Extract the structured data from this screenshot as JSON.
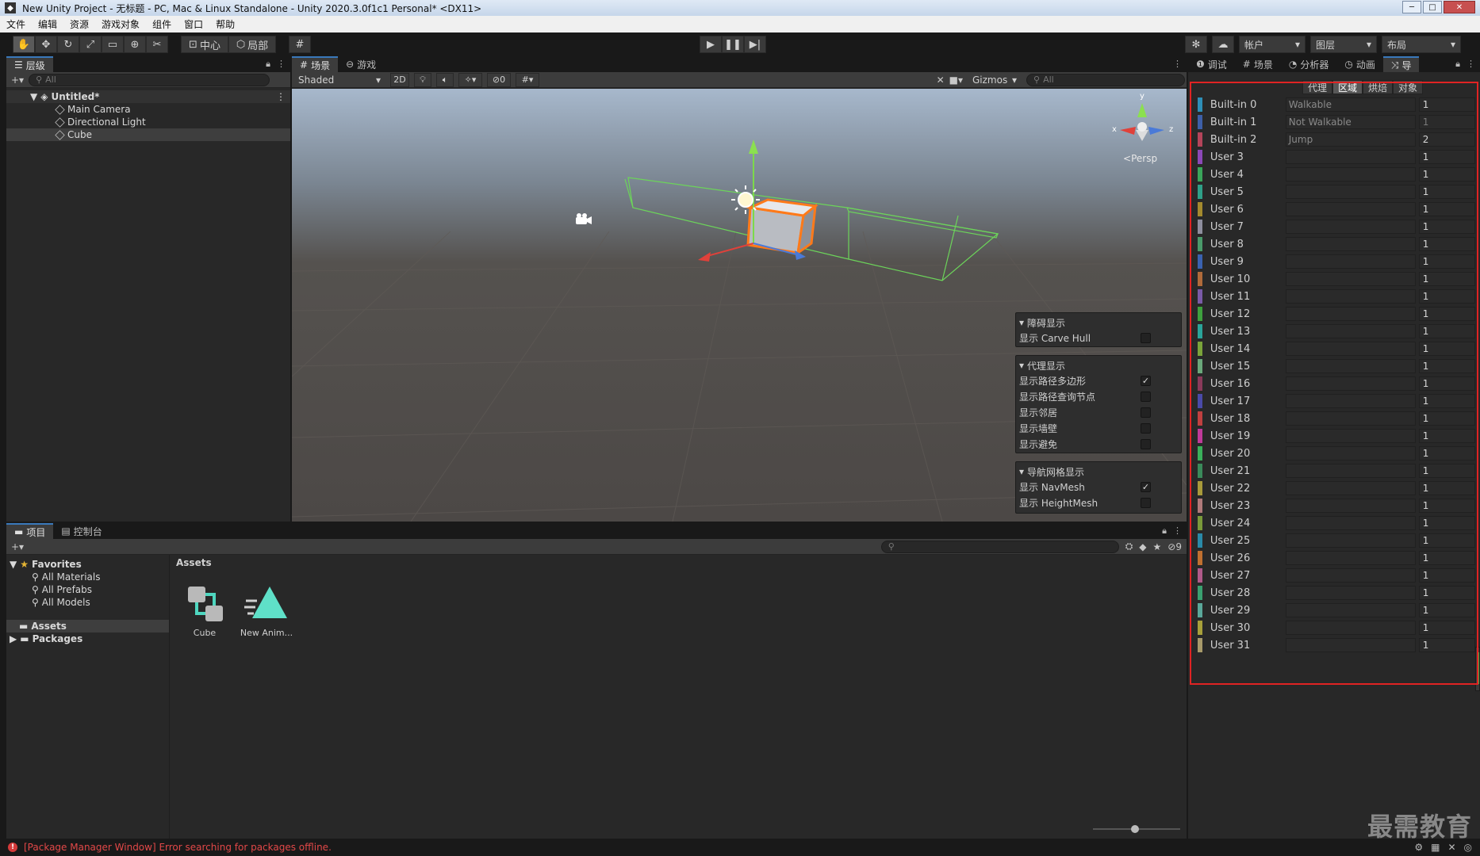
{
  "window": {
    "title": "New Unity Project - 无标题 - PC, Mac & Linux Standalone - Unity 2020.3.0f1c1 Personal* <DX11>",
    "app_icon": "unity-logo-icon"
  },
  "menu": [
    "文件",
    "编辑",
    "资源",
    "游戏对象",
    "组件",
    "窗口",
    "帮助"
  ],
  "toolbar": {
    "pivot_label": "中心",
    "space_label": "局部",
    "account_label": "帐户",
    "layers_label": "图层",
    "layout_label": "布局"
  },
  "hierarchy": {
    "tab_label": "层级",
    "search_placeholder": "All",
    "scene_name": "Untitled*",
    "objects": [
      "Main Camera",
      "Directional Light",
      "Cube"
    ]
  },
  "scene_view": {
    "tabs": [
      "场景",
      "游戏"
    ],
    "shading_mode": "Shaded",
    "mode_2d": "2D",
    "hidden_count": "0",
    "gizmos_label": "Gizmos",
    "search_placeholder": "All",
    "persp_label": "Persp",
    "axis_labels": {
      "y": "y",
      "x": "x",
      "z": "z"
    },
    "overlays": {
      "obstacle": {
        "title": "障碍显示",
        "rows": [
          {
            "label": "显示 Carve Hull",
            "checked": false
          }
        ]
      },
      "agent": {
        "title": "代理显示",
        "rows": [
          {
            "label": "显示路径多边形",
            "checked": true
          },
          {
            "label": "显示路径查询节点",
            "checked": false
          },
          {
            "label": "显示邻居",
            "checked": false
          },
          {
            "label": "显示墙壁",
            "checked": false
          },
          {
            "label": "显示避免",
            "checked": false
          }
        ]
      },
      "navmesh": {
        "title": "导航网格显示",
        "rows": [
          {
            "label": "显示 NavMesh",
            "checked": true
          },
          {
            "label": "显示 HeightMesh",
            "checked": false
          }
        ]
      }
    }
  },
  "inspector": {
    "tabs": [
      "调试",
      "场景",
      "分析器",
      "动画",
      "导"
    ],
    "nav_tabs": [
      "代理",
      "区域",
      "烘焙",
      "对象"
    ],
    "active_nav_tab": "区域",
    "areas": [
      {
        "label": "Built-in 0",
        "name": "Walkable",
        "cost": "1",
        "color": "#2e8fb8"
      },
      {
        "label": "Built-in 1",
        "name": "Not Walkable",
        "cost": "1",
        "color": "#3d5fa8"
      },
      {
        "label": "Built-in 2",
        "name": "Jump",
        "cost": "2",
        "color": "#b4445a"
      },
      {
        "label": "User 3",
        "name": "",
        "cost": "1",
        "color": "#8b48b8"
      },
      {
        "label": "User 4",
        "name": "",
        "cost": "1",
        "color": "#3aa55a"
      },
      {
        "label": "User 5",
        "name": "",
        "cost": "1",
        "color": "#2fa088"
      },
      {
        "label": "User 6",
        "name": "",
        "cost": "1",
        "color": "#a48a2e"
      },
      {
        "label": "User 7",
        "name": "",
        "cost": "1",
        "color": "#8e8e9e"
      },
      {
        "label": "User 8",
        "name": "",
        "cost": "1",
        "color": "#4a9a6a"
      },
      {
        "label": "User 9",
        "name": "",
        "cost": "1",
        "color": "#3a62b0"
      },
      {
        "label": "User 10",
        "name": "",
        "cost": "1",
        "color": "#b06a3a"
      },
      {
        "label": "User 11",
        "name": "",
        "cost": "1",
        "color": "#7a5aa8"
      },
      {
        "label": "User 12",
        "name": "",
        "cost": "1",
        "color": "#3ea03e"
      },
      {
        "label": "User 13",
        "name": "",
        "cost": "1",
        "color": "#2aa49a"
      },
      {
        "label": "User 14",
        "name": "",
        "cost": "1",
        "color": "#7aa43a"
      },
      {
        "label": "User 15",
        "name": "",
        "cost": "1",
        "color": "#6aa87a"
      },
      {
        "label": "User 16",
        "name": "",
        "cost": "1",
        "color": "#8a3a5a"
      },
      {
        "label": "User 17",
        "name": "",
        "cost": "1",
        "color": "#4a4aa8"
      },
      {
        "label": "User 18",
        "name": "",
        "cost": "1",
        "color": "#c04040"
      },
      {
        "label": "User 19",
        "name": "",
        "cost": "1",
        "color": "#c03a9a"
      },
      {
        "label": "User 20",
        "name": "",
        "cost": "1",
        "color": "#3ab05a"
      },
      {
        "label": "User 21",
        "name": "",
        "cost": "1",
        "color": "#3a8a5a"
      },
      {
        "label": "User 22",
        "name": "",
        "cost": "1",
        "color": "#a89a3a"
      },
      {
        "label": "User 23",
        "name": "",
        "cost": "1",
        "color": "#b07a7a"
      },
      {
        "label": "User 24",
        "name": "",
        "cost": "1",
        "color": "#7a9a3a"
      },
      {
        "label": "User 25",
        "name": "",
        "cost": "1",
        "color": "#2a8aa8"
      },
      {
        "label": "User 26",
        "name": "",
        "cost": "1",
        "color": "#c07030"
      },
      {
        "label": "User 27",
        "name": "",
        "cost": "1",
        "color": "#b05a8a"
      },
      {
        "label": "User 28",
        "name": "",
        "cost": "1",
        "color": "#3aa070"
      },
      {
        "label": "User 29",
        "name": "",
        "cost": "1",
        "color": "#5aa89a"
      },
      {
        "label": "User 30",
        "name": "",
        "cost": "1",
        "color": "#a8a03a"
      },
      {
        "label": "User 31",
        "name": "",
        "cost": "1",
        "color": "#a89a6a"
      }
    ]
  },
  "project": {
    "tabs": [
      "项目",
      "控制台"
    ],
    "hidden_count": "9",
    "favorites_label": "Favorites",
    "favorites": [
      "All Materials",
      "All Prefabs",
      "All Models"
    ],
    "folders": [
      "Assets",
      "Packages"
    ],
    "breadcrumb": "Assets",
    "assets": [
      {
        "name": "Cube",
        "icon": "prefab-icon"
      },
      {
        "name": "New Anim...",
        "icon": "animation-clip-icon"
      }
    ]
  },
  "status": {
    "message": "[Package Manager Window] Error searching for packages offline."
  },
  "watermark": "最需教育"
}
